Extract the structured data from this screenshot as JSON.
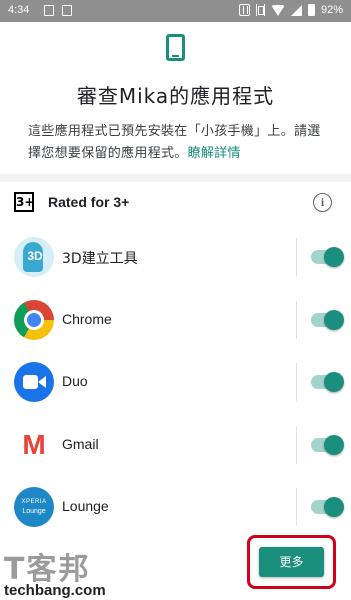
{
  "status_bar": {
    "time": "4:34",
    "battery": "92%"
  },
  "page": {
    "title": "審查Mika的應用程式",
    "description": "這些應用程式已預先安裝在「小孩手機」上。請選擇您想要保留的應用程式。",
    "learn_more": "瞭解詳情"
  },
  "rating": {
    "badge": "3+",
    "label": "Rated for 3+"
  },
  "apps": [
    {
      "name": "3D建立工具",
      "icon": "3d-creator-icon",
      "enabled": true
    },
    {
      "name": "Chrome",
      "icon": "chrome-icon",
      "enabled": true
    },
    {
      "name": "Duo",
      "icon": "duo-icon",
      "enabled": true
    },
    {
      "name": "Gmail",
      "icon": "gmail-icon",
      "enabled": true
    },
    {
      "name": "Lounge",
      "icon": "xperia-lounge-icon",
      "enabled": true
    }
  ],
  "icon_text": {
    "3d": "3D",
    "gmail": "M",
    "lounge_top": "XPERIA",
    "lounge_bottom": "Lounge"
  },
  "more_button": "更多",
  "watermark": {
    "big": "T客邦",
    "small": "techbang.com"
  },
  "colors": {
    "accent": "#1a8f7d",
    "highlight": "#d0021b"
  }
}
